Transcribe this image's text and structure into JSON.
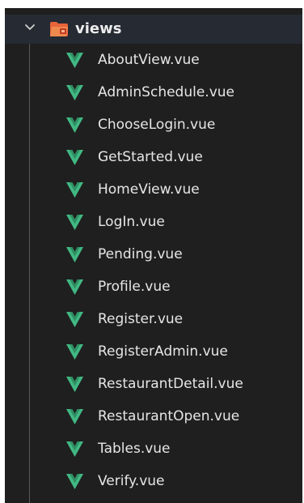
{
  "explorer": {
    "folder": {
      "name": "views",
      "expanded": true,
      "icon": "folder-open-icon",
      "chevron": "chevron-down-icon"
    },
    "files": [
      {
        "name": "AboutView.vue",
        "icon": "vue-icon"
      },
      {
        "name": "AdminSchedule.vue",
        "icon": "vue-icon"
      },
      {
        "name": "ChooseLogin.vue",
        "icon": "vue-icon"
      },
      {
        "name": "GetStarted.vue",
        "icon": "vue-icon"
      },
      {
        "name": "HomeView.vue",
        "icon": "vue-icon"
      },
      {
        "name": "LogIn.vue",
        "icon": "vue-icon"
      },
      {
        "name": "Pending.vue",
        "icon": "vue-icon"
      },
      {
        "name": "Profile.vue",
        "icon": "vue-icon"
      },
      {
        "name": "Register.vue",
        "icon": "vue-icon"
      },
      {
        "name": "RegisterAdmin.vue",
        "icon": "vue-icon"
      },
      {
        "name": "RestaurantDetail.vue",
        "icon": "vue-icon"
      },
      {
        "name": "RestaurantOpen.vue",
        "icon": "vue-icon"
      },
      {
        "name": "Tables.vue",
        "icon": "vue-icon"
      },
      {
        "name": "Verify.vue",
        "icon": "vue-icon"
      }
    ]
  },
  "colors": {
    "panel_bg": "#1f1f1f",
    "folder_row_bg": "#262a33",
    "text": "#e6e6e6",
    "vue_green": "#41b883",
    "folder_orange": "#e8643a"
  }
}
